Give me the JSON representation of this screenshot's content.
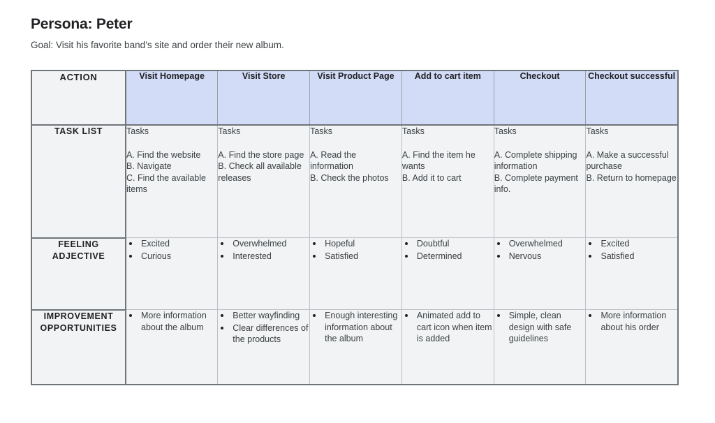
{
  "header": {
    "title": "Persona: Peter",
    "goal": "Goal: Visit his favorite band’s site and order their new album."
  },
  "table": {
    "colors": {
      "header_accent": "#d2dcf7",
      "cell_background": "#f1f3f4",
      "outer_border": "#70757a",
      "inner_border": "#bdc1c6",
      "text": "#3c4043"
    },
    "corner_label": "ACTION",
    "stages": [
      "Visit Homepage",
      "Visit Store",
      "Visit Product Page",
      "Add to cart item",
      "Checkout",
      "Checkout successful"
    ],
    "rows": [
      {
        "label": "TASK LIST",
        "type": "tasks",
        "cells": [
          {
            "heading": "Tasks",
            "lines": "A. Find the website\nB. Navigate\nC. Find the available items"
          },
          {
            "heading": "Tasks",
            "lines": "A. Find the store page\nB. Check all available releases"
          },
          {
            "heading": "Tasks",
            "lines": "A. Read the information\nB. Check the photos"
          },
          {
            "heading": "Tasks",
            "lines": "A. Find the item he wants\nB. Add it to cart"
          },
          {
            "heading": "Tasks",
            "lines": "A. Complete shipping information\nB. Complete payment info."
          },
          {
            "heading": "Tasks",
            "lines": "A. Make a successful purchase\nB. Return to homepage"
          }
        ]
      },
      {
        "label": "FEELING ADJECTIVE",
        "type": "bullets",
        "cells": [
          {
            "items": [
              "Excited",
              "Curious"
            ]
          },
          {
            "items": [
              "Overwhelmed",
              "Interested"
            ]
          },
          {
            "items": [
              "Hopeful",
              "Satisfied"
            ]
          },
          {
            "items": [
              "Doubtful",
              "Determined"
            ]
          },
          {
            "items": [
              "Overwhelmed",
              "Nervous"
            ]
          },
          {
            "items": [
              "Excited",
              "Satisfied"
            ]
          }
        ]
      },
      {
        "label": "IMPROVEMENT OPPORTUNITIES",
        "type": "bullets",
        "cells": [
          {
            "items": [
              "More information about the album"
            ]
          },
          {
            "items": [
              "Better wayfinding",
              "Clear differences of the products"
            ]
          },
          {
            "items": [
              "Enough interesting information about the album"
            ]
          },
          {
            "items": [
              "Animated add to cart icon when item is added"
            ]
          },
          {
            "items": [
              "Simple, clean design with safe guidelines"
            ]
          },
          {
            "items": [
              "More information about his order"
            ]
          }
        ]
      }
    ]
  }
}
